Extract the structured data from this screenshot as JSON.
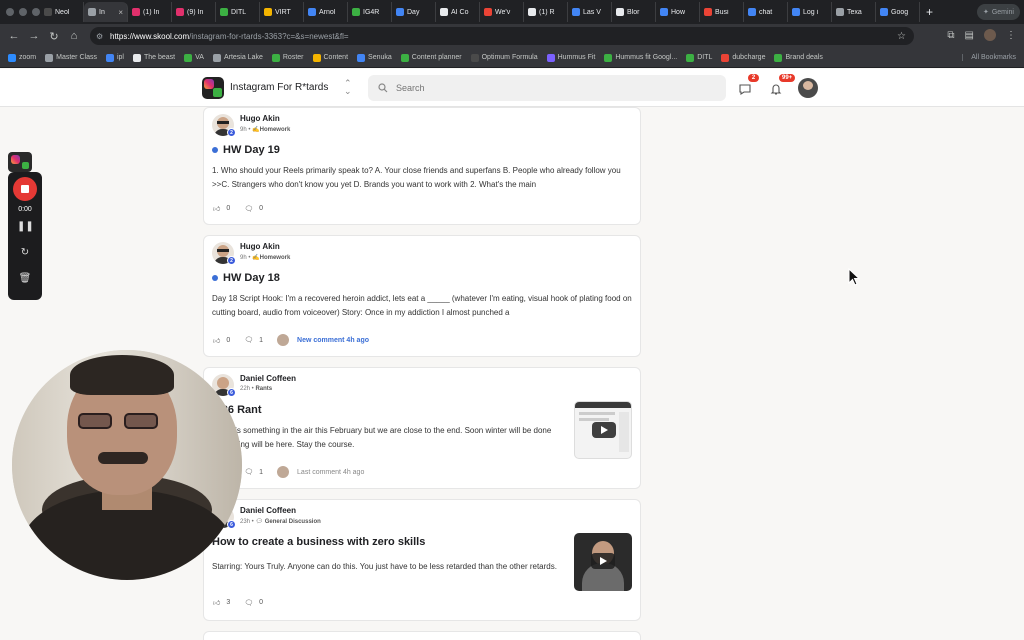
{
  "browser": {
    "tabs": [
      {
        "label": "Neol",
        "color": "#4a4a4a"
      },
      {
        "label": "In",
        "color": "#9aa0a6",
        "active": true
      },
      {
        "label": "(1) In",
        "color": "#e1306c"
      },
      {
        "label": "(9) In",
        "color": "#e1306c"
      },
      {
        "label": "DITL",
        "color": "#3cb043"
      },
      {
        "label": "VIRT",
        "color": "#f4b400"
      },
      {
        "label": "Arnol",
        "color": "#4285f4"
      },
      {
        "label": "IG4R",
        "color": "#3cb043"
      },
      {
        "label": "Day",
        "color": "#4285f4"
      },
      {
        "label": "AI Co",
        "color": "#e8eaed"
      },
      {
        "label": "We'v",
        "color": "#ea4335"
      },
      {
        "label": "(1) R",
        "color": "#e8eaed"
      },
      {
        "label": "Las V",
        "color": "#4285f4"
      },
      {
        "label": "Blor",
        "color": "#e8eaed"
      },
      {
        "label": "How",
        "color": "#4285f4"
      },
      {
        "label": "Busi",
        "color": "#ea4335"
      },
      {
        "label": "chat",
        "color": "#4285f4"
      },
      {
        "label": "Log i",
        "color": "#4285f4"
      },
      {
        "label": "Texa",
        "color": "#9aa0a6"
      },
      {
        "label": "Goog",
        "color": "#4285f4"
      }
    ],
    "new_tab": "+",
    "gemini_label": "Gemini",
    "url_host": "https://www.skool.com",
    "url_path": "/instagram-for-rtards-3363?c=&s=newest&fl=",
    "bookmarks": [
      {
        "label": "zoom",
        "color": "#2d8cff"
      },
      {
        "label": "Master Class",
        "color": "#9aa0a6"
      },
      {
        "label": "ipl",
        "color": "#4285f4"
      },
      {
        "label": "The beast",
        "color": "#e8eaed"
      },
      {
        "label": "VA",
        "color": "#3cb043"
      },
      {
        "label": "Artesia Lake",
        "color": "#9aa0a6"
      },
      {
        "label": "Roster",
        "color": "#3cb043"
      },
      {
        "label": "Content",
        "color": "#f4b400"
      },
      {
        "label": "Senuka",
        "color": "#4285f4"
      },
      {
        "label": "Content planner",
        "color": "#3cb043"
      },
      {
        "label": "Optimum Formula",
        "color": "#4a4a4a"
      },
      {
        "label": "Hummus Fit",
        "color": "#7b61ff"
      },
      {
        "label": "Hummus fit Googl...",
        "color": "#3cb043"
      },
      {
        "label": "DITL",
        "color": "#3cb043"
      },
      {
        "label": "dubcharge",
        "color": "#ea4335"
      },
      {
        "label": "Brand deals",
        "color": "#3cb043"
      }
    ],
    "all_bookmarks": "All Bookmarks"
  },
  "header": {
    "group_name": "Instagram For R*tards",
    "search_placeholder": "Search",
    "chat_badge": "2",
    "notif_badge": "99+"
  },
  "posts": [
    {
      "author": "Hugo Akin",
      "level": "2",
      "time": "9h",
      "category": "Homework",
      "title": "HW Day 19",
      "unread": true,
      "body": "1. Who should your Reels primarily speak to? A. Your close friends and superfans B. People who already follow you >>C. Strangers who don't know you yet D. Brands you want to work with 2. What's the main",
      "likes": "0",
      "comments": "0"
    },
    {
      "author": "Hugo Akin",
      "level": "2",
      "time": "9h",
      "category": "Homework",
      "title": "HW Day 18",
      "unread": true,
      "body": "Day 18 Script Hook: I'm a recovered heroin addict, lets eat a _____ (whatever I'm eating, visual hook of plating food on cutting board, audio from voiceover) Story: Once in my addiction I almost punched a",
      "likes": "0",
      "comments": "1",
      "activity": "New comment 4h ago"
    },
    {
      "author": "Daniel Coffeen",
      "level": "6",
      "time": "22h",
      "category": "Rants",
      "title": "2-26 Rant",
      "body": "There is something in the air this February but we are close to the end. Soon winter will be done and spring will be here. Stay the course.",
      "likes": "0",
      "comments": "1",
      "activity": "Last comment 4h ago"
    },
    {
      "author": "Daniel Coffeen",
      "level": "6",
      "time": "23h",
      "category": "General Discussion",
      "title": "How to create a business with zero skills",
      "body": "Starring: Yours Truly. Anyone can do this. You just have to be less retarded than the other retards.",
      "likes": "3",
      "comments": "0"
    }
  ],
  "recorder": {
    "time": "0:00"
  }
}
